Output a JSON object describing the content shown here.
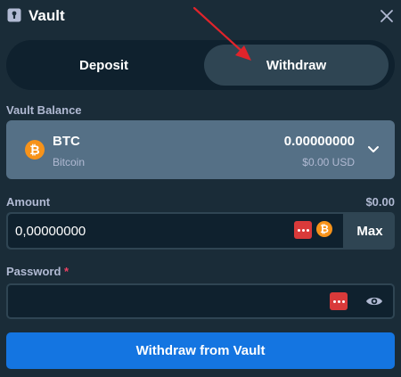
{
  "header": {
    "title": "Vault",
    "icon": "vault-lock-icon",
    "close_icon": "close-icon"
  },
  "tabs": [
    {
      "label": "Deposit",
      "active": false
    },
    {
      "label": "Withdraw",
      "active": true
    }
  ],
  "vault_balance": {
    "label": "Vault Balance",
    "currency_code": "BTC",
    "currency_name": "Bitcoin",
    "coin_symbol": "₿",
    "amount": "0.00000000",
    "usd_value": "$0.00 USD"
  },
  "amount": {
    "label": "Amount",
    "usd_value": "$0.00",
    "value": "0,00000000",
    "coin_symbol": "₿",
    "max_label": "Max"
  },
  "password": {
    "label": "Password",
    "required_mark": "*",
    "value": ""
  },
  "submit_label": "Withdraw from Vault",
  "colors": {
    "background": "#1a2c38",
    "input_bg": "#0f212e",
    "panel": "#2f4553",
    "balance_bg": "#557086",
    "primary_button": "#1475e1",
    "bitcoin": "#f7931a",
    "required": "#ed4163",
    "annotation_arrow": "#e0242b"
  }
}
